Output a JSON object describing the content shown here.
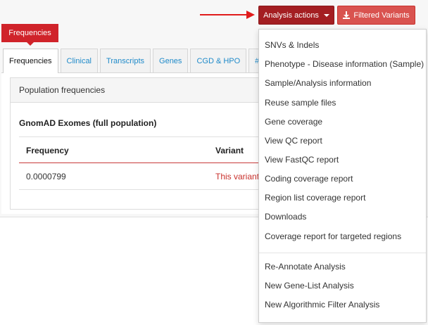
{
  "toolbar": {
    "analysis_actions_label": "Analysis actions",
    "filtered_variants_label": "Filtered Variants",
    "accent": "#a41e22",
    "secondary": "#d9534f"
  },
  "tooltip": {
    "text": "Frequencies"
  },
  "tabs": [
    {
      "label": "Frequencies"
    },
    {
      "label": "Clinical"
    },
    {
      "label": "Transcripts"
    },
    {
      "label": "Genes"
    },
    {
      "label": "CGD & HPO"
    },
    {
      "label": "# S"
    }
  ],
  "card": {
    "title": "Population frequencies",
    "subtitle": "GnomAD Exomes (full population)",
    "columns": [
      "Frequency",
      "Variant"
    ],
    "rows": [
      {
        "frequency": "0.0000799",
        "variant": "This variant"
      }
    ]
  },
  "menu": {
    "group1": [
      "SNVs & Indels",
      "Phenotype - Disease information (Sample)",
      "Sample/Analysis information",
      "Reuse sample files",
      "Gene coverage",
      "View QC report",
      "View FastQC report",
      "Coding coverage report",
      "Region list coverage report",
      "Downloads",
      "Coverage report for targeted regions"
    ],
    "group2": [
      "Re-Annotate Analysis",
      "New Gene-List Analysis",
      "New Algorithmic Filter Analysis"
    ]
  },
  "icons": {
    "download": "download-icon",
    "caret": "caret-down-icon",
    "arrow": "arrow-right-icon"
  }
}
